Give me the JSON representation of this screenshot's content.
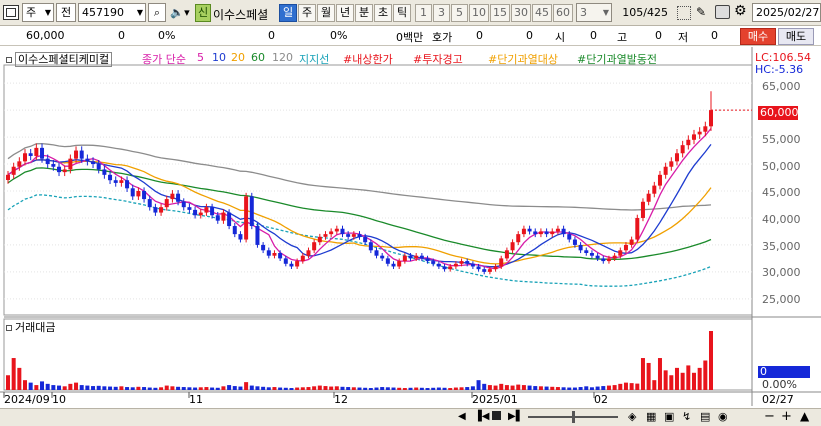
{
  "toolbar": {
    "market": "주",
    "type": "전",
    "code": "457190",
    "badge": "신",
    "stock_name": "이수스페셜",
    "periods": [
      "일",
      "주",
      "월",
      "년",
      "분",
      "초",
      "틱"
    ],
    "active_period": "일",
    "numbers": [
      "1",
      "3",
      "5",
      "10",
      "15",
      "30",
      "45",
      "60"
    ],
    "count": "3",
    "page": "105/425",
    "date": "2025/02/27"
  },
  "quote": {
    "price": "60,000",
    "v1": "0",
    "p1": "0%",
    "v2": "0",
    "p2": "0%",
    "amount": "0백만",
    "hoga_label": "호가",
    "hoga_value": "0",
    "v3": "0",
    "si_label": "시",
    "si_value": "0",
    "go_label": "고",
    "go_value": "0",
    "jeo_label": "저",
    "jeo_value": "0",
    "buy": "매수",
    "sell": "매도"
  },
  "legend": {
    "name": "이수스페셜티케미컬",
    "ma_label": "종가 단순",
    "ma5": "5",
    "ma10": "10",
    "ma20": "20",
    "ma60": "60",
    "ma120": "120",
    "support": "지지선",
    "i1": "#내상한가",
    "i2": "#투자경고",
    "i3": "#단기과열대상",
    "i4": "#단기과열발동전",
    "lc": "LC:106.54",
    "hc": "HC:-5.36",
    "volume": "거래대금"
  },
  "axis": {
    "y": [
      "65,000",
      "55,000",
      "50,000",
      "45,000",
      "40,000",
      "35,000",
      "30,000",
      "25,000"
    ],
    "current": "60,000",
    "vol_current": "0",
    "vol_pct": "0.00%",
    "x": [
      "2024/09",
      "10",
      "11",
      "12",
      "2025/01",
      "02",
      "02/27"
    ]
  },
  "colors": {
    "up": "#e8141c",
    "down": "#1528d8",
    "ma5": "#d81ca8",
    "ma10": "#1e3cd0",
    "ma20": "#f0a000",
    "ma60": "#1a8a2a",
    "ma120": "#8c8c8c",
    "support": "#1aa3b8"
  },
  "chart_data": {
    "type": "candlestick",
    "y_range": [
      22000,
      68000
    ],
    "last_close": 60000,
    "closes": [
      48000,
      49500,
      50500,
      52000,
      51500,
      53000,
      51000,
      50000,
      49500,
      48500,
      49000,
      51000,
      52500,
      51000,
      50500,
      50000,
      49000,
      48000,
      47000,
      46500,
      47000,
      45500,
      44000,
      45000,
      43500,
      42000,
      41000,
      42000,
      43500,
      44500,
      43000,
      42000,
      41500,
      40500,
      41000,
      42000,
      40500,
      39500,
      41000,
      38500,
      37000,
      36000,
      44000,
      38500,
      35000,
      34000,
      33000,
      33500,
      32500,
      31500,
      31000,
      32000,
      33000,
      34000,
      35500,
      36500,
      37000,
      37500,
      38000,
      37000,
      36500,
      37000,
      36500,
      35500,
      34000,
      33000,
      32500,
      31500,
      31000,
      32000,
      33000,
      32500,
      33000,
      32500,
      32000,
      31500,
      31000,
      30500,
      31000,
      31500,
      32000,
      31500,
      31000,
      30500,
      30000,
      30500,
      31000,
      32500,
      34000,
      35500,
      37000,
      38000,
      37500,
      37000,
      37500,
      37000,
      37500,
      38000,
      37000,
      36000,
      35000,
      34000,
      33500,
      33000,
      32500,
      32000,
      32500,
      33000,
      34000,
      35000,
      36000,
      40000,
      43000,
      44500,
      46000,
      48000,
      49500,
      50500,
      52000,
      53500,
      54500,
      55500,
      56000,
      57000,
      60000
    ],
    "volumes": [
      600,
      1300,
      900,
      400,
      300,
      200,
      350,
      250,
      200,
      180,
      150,
      250,
      300,
      200,
      180,
      160,
      170,
      150,
      140,
      130,
      150,
      120,
      110,
      130,
      120,
      100,
      90,
      110,
      180,
      150,
      130,
      120,
      110,
      100,
      110,
      120,
      100,
      90,
      150,
      200,
      160,
      140,
      320,
      180,
      150,
      130,
      110,
      120,
      100,
      90,
      80,
      100,
      110,
      120,
      150,
      180,
      160,
      140,
      150,
      130,
      120,
      110,
      100,
      90,
      80,
      100,
      120,
      110,
      100,
      90,
      80,
      90,
      100,
      90,
      80,
      90,
      100,
      90,
      80,
      100,
      110,
      120,
      150,
      400,
      250,
      200,
      180,
      250,
      200,
      180,
      220,
      200,
      180,
      160,
      150,
      140,
      130,
      120,
      110,
      100,
      100,
      120,
      150,
      110,
      140,
      160,
      180,
      200,
      250,
      300,
      280,
      260,
      1300,
      1100,
      400,
      1300,
      800,
      600,
      900,
      700,
      1000,
      700,
      900,
      1200,
      2400
    ]
  }
}
